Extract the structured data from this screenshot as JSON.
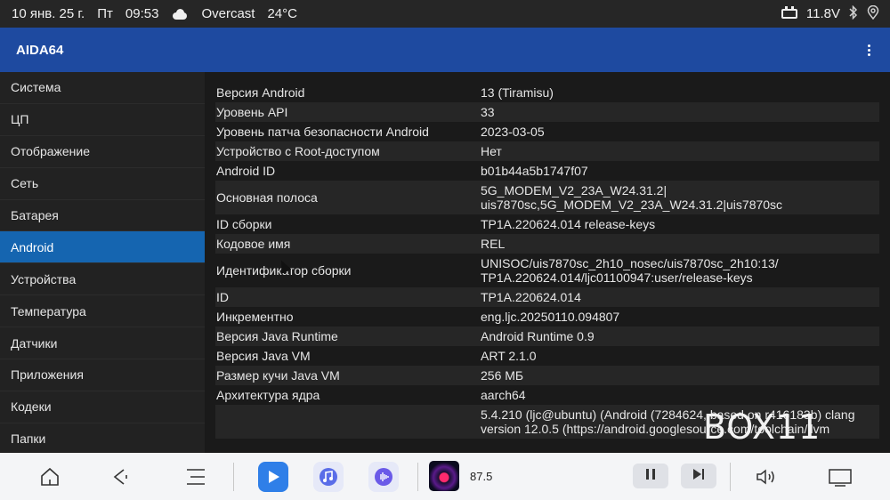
{
  "statusbar": {
    "date": "10 янв. 25 г.",
    "weekday": "Пт",
    "time": "09:53",
    "weather_icon": "cloud-icon",
    "weather": "Overcast",
    "temperature": "24°C",
    "voltage": "11.8V"
  },
  "appbar": {
    "title": "AIDA64"
  },
  "sidebar": {
    "items": [
      {
        "label": "Система",
        "active": false
      },
      {
        "label": "ЦП",
        "active": false
      },
      {
        "label": "Отображение",
        "active": false
      },
      {
        "label": "Сеть",
        "active": false
      },
      {
        "label": "Батарея",
        "active": false
      },
      {
        "label": "Android",
        "active": true
      },
      {
        "label": "Устройства",
        "active": false
      },
      {
        "label": "Температура",
        "active": false
      },
      {
        "label": "Датчики",
        "active": false
      },
      {
        "label": "Приложения",
        "active": false
      },
      {
        "label": "Кодеки",
        "active": false
      },
      {
        "label": "Папки",
        "active": false
      }
    ]
  },
  "details": [
    {
      "key": "Версия Android",
      "value": "13 (Tiramisu)"
    },
    {
      "key": "Уровень API",
      "value": "33"
    },
    {
      "key": "Уровень патча безопасности Android",
      "value": "2023-03-05"
    },
    {
      "key": "Устройство с Root-доступом",
      "value": "Нет"
    },
    {
      "key": "Android ID",
      "value": "b01b44a5b1747f07"
    },
    {
      "key": "Основная полоса",
      "value": "5G_MODEM_V2_23A_W24.31.2|\nuis7870sc,5G_MODEM_V2_23A_W24.31.2|uis7870sc"
    },
    {
      "key": "ID сборки",
      "value": "TP1A.220624.014 release-keys"
    },
    {
      "key": "Кодовое имя",
      "value": "REL"
    },
    {
      "key": "Идентификатор сборки",
      "value": "UNISOC/uis7870sc_2h10_nosec/uis7870sc_2h10:13/\nTP1A.220624.014/ljc01100947:user/release-keys"
    },
    {
      "key": "ID",
      "value": "TP1A.220624.014"
    },
    {
      "key": "Инкрементно",
      "value": "eng.ljc.20250110.094807"
    },
    {
      "key": "Версия Java Runtime",
      "value": "Android Runtime 0.9"
    },
    {
      "key": "Версия Java VM",
      "value": "ART 2.1.0"
    },
    {
      "key": "Размер кучи Java VM",
      "value": "256 МБ"
    },
    {
      "key": "Архитектура ядра",
      "value": "aarch64"
    },
    {
      "key": "",
      "value": "5.4.210 (ljc@ubuntu) (Android (7284624, based on r416183b) clang\nversion 12.0.5 (https://android.googlesource.com/toolchain/llvm"
    }
  ],
  "watermark": "BOX11",
  "dock": {
    "radio_frequency": "87.5",
    "icons": [
      "home-icon",
      "back-icon",
      "menu-icon",
      "play-app-icon",
      "music-app-icon",
      "voice-app-icon",
      "pause-icon",
      "next-icon",
      "volume-icon",
      "screen-icon"
    ]
  },
  "colors": {
    "appbar": "#1e4aa0",
    "sidebar_active": "#1565b0",
    "background": "#1a1a1a",
    "dock": "#f4f5f7"
  }
}
